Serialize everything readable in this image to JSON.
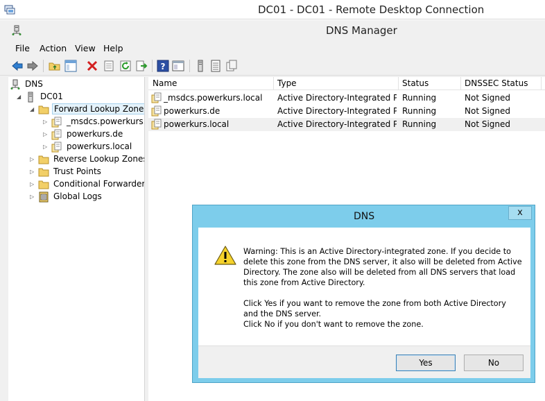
{
  "rdp": {
    "title": "DC01 - DC01 - Remote Desktop Connection"
  },
  "window": {
    "title": "DNS Manager"
  },
  "menu": [
    "File",
    "Action",
    "View",
    "Help"
  ],
  "toolbar": {
    "icons": [
      "back-arrow-icon",
      "forward-arrow-icon",
      "up-folder-icon",
      "show-hide-tree-icon",
      "delete-icon",
      "properties-icon",
      "refresh-icon",
      "export-list-icon",
      "help-icon",
      "console-icon",
      "server-icon",
      "list-icon",
      "zone-icon"
    ]
  },
  "tree": [
    {
      "label": "DNS",
      "icon": "dns-icon",
      "expander": "",
      "depth": 0
    },
    {
      "label": "DC01",
      "icon": "server-icon",
      "expander": "◢",
      "depth": 1
    },
    {
      "label": "Forward Lookup Zones",
      "icon": "folder-icon",
      "expander": "◢",
      "depth": 2
    },
    {
      "label": "_msdcs.powerkurs.lo",
      "icon": "zone-icon",
      "expander": "▷",
      "depth": 3
    },
    {
      "label": "powerkurs.de",
      "icon": "zone-icon",
      "expander": "▷",
      "depth": 3
    },
    {
      "label": "powerkurs.local",
      "icon": "zone-icon",
      "expander": "▷",
      "depth": 3
    },
    {
      "label": "Reverse Lookup Zones",
      "icon": "folder-icon",
      "expander": "▷",
      "depth": 2
    },
    {
      "label": "Trust Points",
      "icon": "folder-icon",
      "expander": "▷",
      "depth": 2
    },
    {
      "label": "Conditional Forwarders",
      "icon": "folder-icon",
      "expander": "▷",
      "depth": 2
    },
    {
      "label": "Global Logs",
      "icon": "log-icon",
      "expander": "▷",
      "depth": 2
    }
  ],
  "list": {
    "columns": [
      "Name",
      "Type",
      "Status",
      "DNSSEC Status"
    ],
    "rows": [
      {
        "name": "_msdcs.powerkurs.local",
        "type": "Active Directory-Integrated Pr...",
        "status": "Running",
        "dnssec": "Not Signed"
      },
      {
        "name": "powerkurs.de",
        "type": "Active Directory-Integrated Pr...",
        "status": "Running",
        "dnssec": "Not Signed"
      },
      {
        "name": "powerkurs.local",
        "type": "Active Directory-Integrated Pr...",
        "status": "Running",
        "dnssec": "Not Signed"
      }
    ]
  },
  "dialog": {
    "title": "DNS",
    "close": "x",
    "message1": "Warning: This is an Active Directory-integrated zone. If you decide to\ndelete this zone from the DNS server, it also will be deleted from Active\nDirectory. The zone also will be deleted from all DNS servers that load\nthis zone from Active Directory.",
    "message2": "Click Yes if you want to remove the zone from both Active Directory\nand the DNS server.\nClick No if you don't want to remove the zone.",
    "yes": "Yes",
    "no": "No"
  },
  "colors": {
    "dialog_frame": "#7dcdeb",
    "selection": "#e5f3fb",
    "row_highlight": "#f0f0f0"
  }
}
